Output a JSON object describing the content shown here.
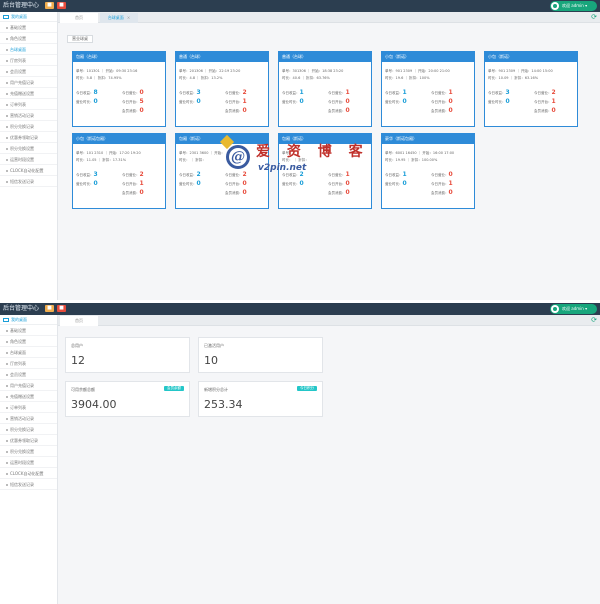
{
  "panels": [
    {
      "topbar": {
        "brand": "后台管理中心",
        "btn1": "■",
        "btn2": "■",
        "user": "欢迎 admin ▾"
      },
      "sidebar": {
        "header": "我的桌面",
        "items": [
          {
            "label": "基础设置"
          },
          {
            "label": "角色设置"
          },
          {
            "label": "台球桌面"
          },
          {
            "label": "厅房列表"
          },
          {
            "label": "会员设置"
          },
          {
            "label": "用户充值记录"
          },
          {
            "label": "充值赠送设置"
          },
          {
            "label": "订单列表"
          },
          {
            "label": "营销活动记录"
          },
          {
            "label": "积分兑换记录"
          },
          {
            "label": "优惠券领取记录"
          },
          {
            "label": "积分兑换设置"
          },
          {
            "label": "运营时段设置"
          },
          {
            "label": "CLOCK自动化配置"
          },
          {
            "label": "短信发送记录"
          }
        ]
      },
      "tabs": [
        {
          "label": "首页"
        },
        {
          "label": "台球桌面",
          "close": "×"
        }
      ],
      "refresh": "⟳",
      "hall_label": "营业球桌"
    },
    {
      "topbar": {
        "brand": "后台管理中心",
        "btn1": "■",
        "btn2": "■",
        "user": "欢迎 admin ▾"
      },
      "sidebar": {
        "header": "我的桌面",
        "items": [
          {
            "label": "基础设置"
          },
          {
            "label": "角色设置"
          },
          {
            "label": "台球桌面"
          },
          {
            "label": "厅房列表"
          },
          {
            "label": "会员设置"
          },
          {
            "label": "用户充值记录"
          },
          {
            "label": "充值赠送设置"
          },
          {
            "label": "订单列表"
          },
          {
            "label": "营销活动记录"
          },
          {
            "label": "积分兑换记录"
          },
          {
            "label": "优惠券领取记录"
          },
          {
            "label": "积分兑换设置"
          },
          {
            "label": "运营时段设置"
          },
          {
            "label": "CLOCK自动化配置"
          },
          {
            "label": "短信发送记录"
          }
        ]
      },
      "tabs": [
        {
          "label": "首页"
        }
      ],
      "refresh": "⟳"
    }
  ],
  "table_cards": [
    {
      "title": "包厢（台球）",
      "order_line": "单号：101301  ｜  开始：09:30 23:16",
      "time_line": "时长：5.8  ｜  折扣：74.95%",
      "stats": {
        "left1_label": "今日收益：",
        "left1": "8",
        "left2_label": "营业时长：",
        "left2": "0",
        "right1_label": "今日营业：",
        "right1": "0",
        "right2_label": "今日开台：",
        "right2": "5",
        "right3_label": "会员消费：",
        "right3": "0"
      }
    },
    {
      "title": "普通（台球）",
      "order_line": "单号：201306  ｜  开始：22:19 23:20",
      "time_line": "时长：4.8  ｜  折扣：13.2%",
      "stats": {
        "left1_label": "今日收益：",
        "left1": "3",
        "left2_label": "营业时长：",
        "left2": "0",
        "right1_label": "今日营业：",
        "right1": "2",
        "right2_label": "今日开台：",
        "right2": "1",
        "right3_label": "会员消费：",
        "right3": "0"
      }
    },
    {
      "title": "普通（台球）",
      "order_line": "单号：301306  ｜  开始：18:38 23:20",
      "time_line": "时长：40.6  ｜  折扣：63.76%",
      "stats": {
        "left1_label": "今日收益：",
        "left1": "1",
        "left2_label": "营业时长：",
        "left2": "0",
        "right1_label": "今日营业：",
        "right1": "1",
        "right2_label": "今日开台：",
        "right2": "0",
        "right3_label": "会员消费：",
        "right3": "0"
      }
    },
    {
      "title": "小包（斯诺）",
      "order_line": "单号：901 2309  ｜  开始：20:00 21:00",
      "time_line": "时长：19.6  ｜  折扣：100%",
      "stats": {
        "left1_label": "今日收益：",
        "left1": "1",
        "left2_label": "营业时长：",
        "left2": "0",
        "right1_label": "今日营业：",
        "right1": "1",
        "right2_label": "今日开台：",
        "right2": "0",
        "right3_label": "会员消费：",
        "right3": "0"
      }
    },
    {
      "title": "小包（斯诺）",
      "order_line": "单号：901 2309  ｜  开始：14:00 15:00",
      "time_line": "时长：10.09  ｜  折扣：63.16%",
      "stats": {
        "left1_label": "今日收益：",
        "left1": "3",
        "left2_label": "营业时长：",
        "left2": "0",
        "right1_label": "今日营业：",
        "right1": "2",
        "right2_label": "今日开台：",
        "right2": "1",
        "right3_label": "会员消费：",
        "right3": "0"
      }
    },
    {
      "title": "小包（斯诺包厢）",
      "order_line": "单号：101 2310  ｜  开始：17:20 19:20",
      "time_line": "时长：11.05  ｜  折扣：17.31%",
      "stats": {
        "left1_label": "今日收益：",
        "left1": "3",
        "left2_label": "营业时长：",
        "left2": "0",
        "right1_label": "今日营业：",
        "right1": "2",
        "right2_label": "今日开台：",
        "right2": "1",
        "right3_label": "会员消费：",
        "right3": "0"
      }
    },
    {
      "title": "包厢（斯诺）",
      "order_line": "单号：2301 3600  ｜  开始：",
      "time_line": "时长：  ｜  折扣：",
      "stats": {
        "left1_label": "今日收益：",
        "left1": "2",
        "left2_label": "营业时长：",
        "left2": "0",
        "right1_label": "今日营业：",
        "right1": "2",
        "right2_label": "今日开台：",
        "right2": "0",
        "right3_label": "会员消费：",
        "right3": "0"
      }
    },
    {
      "title": "包厢（斯诺）",
      "order_line": "单号：",
      "time_line": "时长：  ｜  折扣：",
      "stats": {
        "left1_label": "今日收益：",
        "left1": "2",
        "left2_label": "营业时长：",
        "left2": "0",
        "right1_label": "今日营业：",
        "right1": "1",
        "right2_label": "今日开台：",
        "right2": "0",
        "right3_label": "会员消费：",
        "right3": "0"
      }
    },
    {
      "title": "豪华（斯诺包厢）",
      "order_line": "单号：6001 16450  ｜  开始：16:00 17:00",
      "time_line": "时长：19.95  ｜  折扣：100.00%",
      "stats": {
        "left1_label": "今日收益：",
        "left1": "1",
        "left2_label": "营业时长：",
        "left2": "0",
        "right1_label": "今日营业：",
        "right1": "0",
        "right2_label": "今日开台：",
        "right2": "1",
        "right3_label": "会员消费：",
        "right3": "0"
      }
    }
  ],
  "watermark": {
    "cn": "爱 资 博 客",
    "url": "v2pin.net",
    "logo": "@"
  },
  "stats": [
    {
      "label": "总用户",
      "value": "12"
    },
    {
      "label": "已激活用户",
      "value": "10"
    },
    {
      "label": "可用余额总额",
      "value": "3904.00",
      "badge": "会员余额"
    },
    {
      "label": "新增积分总计",
      "value": "253.34",
      "badge": "今日积分"
    }
  ]
}
